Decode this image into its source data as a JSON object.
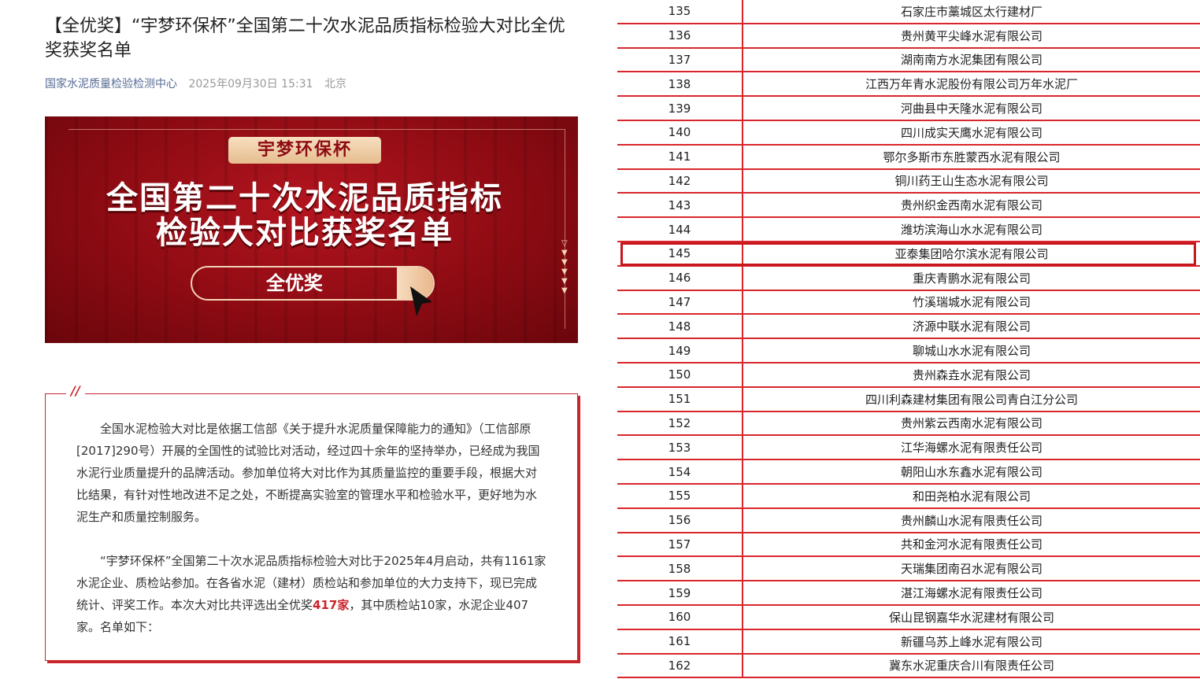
{
  "article": {
    "title": "【全优奖】“宇梦环保杯”全国第二十次水泥品质指标检验大对比全优奖获奖名单",
    "source": "国家水泥质量检验检测中心",
    "time": "2025年09月30日 15:31",
    "location": "北京"
  },
  "banner": {
    "cup_label": "宇梦环保杯",
    "headline_line1": "全国第二十次水泥品质指标",
    "headline_line2": "检验大对比获奖名单",
    "award_button": "全优奖"
  },
  "intro": {
    "slash": "//",
    "p1": "全国水泥检验大对比是依据工信部《关于提升水泥质量保障能力的通知》（工信部原[2017]290号）开展的全国性的试验比对活动，经过四十余年的坚持举办，已经成为我国水泥行业质量提升的品牌活动。参加单位将大对比作为其质量监控的重要手段，根据大对比结果，有针对性地改进不足之处，不断提高实验室的管理水平和检验水平，更好地为水泥生产和质量控制服务。",
    "p2_before": "“宇梦环保杯”全国第二十次水泥品质指标检验大对比于2025年4月启动，共有1161家水泥企业、质检站参加。在各省水泥（建材）质检站和参加单位的大力支持下，现已完成统计、评奖工作。本次大对比共评选出全优奖",
    "p2_highlight": "417家",
    "p2_after": "，其中质检站10家，水泥企业407家。名单如下："
  },
  "winners_table": {
    "highlighted_number": "145",
    "rows": [
      {
        "no": "135",
        "name": "石家庄市藁城区太行建材厂"
      },
      {
        "no": "136",
        "name": "贵州黄平尖峰水泥有限公司"
      },
      {
        "no": "137",
        "name": "湖南南方水泥集团有限公司"
      },
      {
        "no": "138",
        "name": "江西万年青水泥股份有限公司万年水泥厂"
      },
      {
        "no": "139",
        "name": "河曲县中天隆水泥有限公司"
      },
      {
        "no": "140",
        "name": "四川成实天鹰水泥有限公司"
      },
      {
        "no": "141",
        "name": "鄂尔多斯市东胜蒙西水泥有限公司"
      },
      {
        "no": "142",
        "name": "铜川药王山生态水泥有限公司"
      },
      {
        "no": "143",
        "name": "贵州织金西南水泥有限公司"
      },
      {
        "no": "144",
        "name": "潍坊滨海山水水泥有限公司"
      },
      {
        "no": "145",
        "name": "亚泰集团哈尔滨水泥有限公司"
      },
      {
        "no": "146",
        "name": "重庆青鹏水泥有限公司"
      },
      {
        "no": "147",
        "name": "竹溪瑞城水泥有限公司"
      },
      {
        "no": "148",
        "name": "济源中联水泥有限公司"
      },
      {
        "no": "149",
        "name": "聊城山水水泥有限公司"
      },
      {
        "no": "150",
        "name": "贵州森垚水泥有限公司"
      },
      {
        "no": "151",
        "name": "四川利森建材集团有限公司青白江分公司"
      },
      {
        "no": "152",
        "name": "贵州紫云西南水泥有限公司"
      },
      {
        "no": "153",
        "name": "江华海螺水泥有限责任公司"
      },
      {
        "no": "154",
        "name": "朝阳山水东鑫水泥有限公司"
      },
      {
        "no": "155",
        "name": "和田尧柏水泥有限公司"
      },
      {
        "no": "156",
        "name": "贵州麟山水泥有限责任公司"
      },
      {
        "no": "157",
        "name": "共和金河水泥有限责任公司"
      },
      {
        "no": "158",
        "name": "天瑞集团南召水泥有限公司"
      },
      {
        "no": "159",
        "name": "湛江海螺水泥有限责任公司"
      },
      {
        "no": "160",
        "name": "保山昆钢嘉华水泥建材有限公司"
      },
      {
        "no": "161",
        "name": "新疆乌苏上峰水泥有限公司"
      },
      {
        "no": "162",
        "name": "冀东水泥重庆合川有限责任公司"
      }
    ]
  },
  "colors": {
    "accent_red": "#c9242b",
    "table_line": "#d9262c",
    "banner_red": "#9b0e16",
    "link_blue": "#576b95"
  }
}
